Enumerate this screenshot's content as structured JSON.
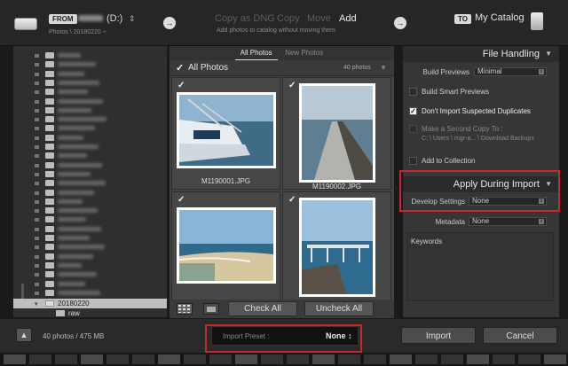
{
  "header": {
    "from_badge": "FROM",
    "source_drive": "(D:)",
    "source_path": "Photos \\ 20180220 ÷",
    "modes": [
      {
        "label": "Copy as DNG",
        "active": false
      },
      {
        "label": "Copy",
        "active": false
      },
      {
        "label": "Move",
        "active": false
      },
      {
        "label": "Add",
        "active": true
      }
    ],
    "mode_description": "Add photos to catalog without moving them",
    "to_badge": "TO",
    "destination": "My Catalog"
  },
  "source_panel": {
    "selected_folder": "20180220",
    "subfolder": "raw"
  },
  "center": {
    "tabs": [
      {
        "label": "All Photos",
        "active": true
      },
      {
        "label": "New Photos",
        "active": false
      }
    ],
    "section_title": "All Photos",
    "count": "40 photos",
    "photos": [
      {
        "filename": "M1190001.JPG",
        "checked": true
      },
      {
        "filename": "M1190002.JPG",
        "checked": true
      },
      {
        "filename": "",
        "checked": true
      },
      {
        "filename": "",
        "checked": true
      }
    ],
    "check_all": "Check All",
    "uncheck_all": "Uncheck All"
  },
  "right_panel": {
    "file_handling": {
      "title": "File Handling",
      "build_previews_label": "Build Previews",
      "build_previews_value": "Minimal",
      "build_smart_previews": "Build Smart Previews",
      "dont_import_duplicates": "Don't Import Suspected Duplicates",
      "second_copy": "Make a Second Copy To :",
      "second_copy_path": "C: \\ Users \\ mgr-a... \\ Download Backups",
      "add_to_collection": "Add to Collection"
    },
    "apply_during_import": {
      "title": "Apply During Import",
      "develop_settings_label": "Develop Settings",
      "develop_settings_value": "None",
      "metadata_label": "Metadata",
      "metadata_value": "None",
      "keywords_label": "Keywords"
    }
  },
  "footer": {
    "status": "40 photos / 475 MB",
    "import_preset_label": "Import Preset :",
    "import_preset_value": "None ↕",
    "import_button": "Import",
    "cancel_button": "Cancel"
  },
  "colors": {
    "highlight_border": "#c8282e",
    "active_mode": "#f0f0f0",
    "inactive_mode": "#5d5d5d"
  }
}
